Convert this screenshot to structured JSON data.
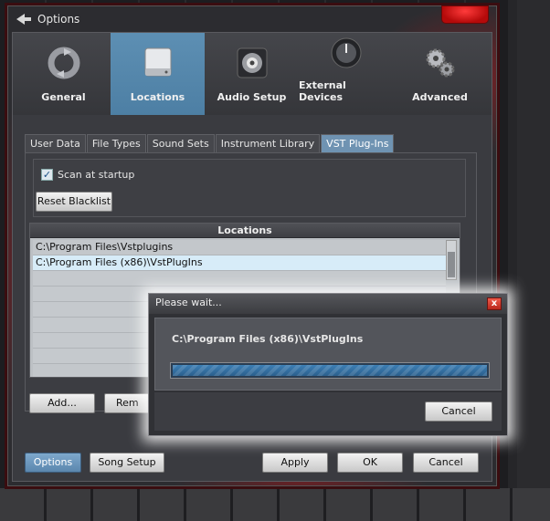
{
  "window": {
    "title": "Options"
  },
  "main_tabs": [
    {
      "label": "General",
      "icon": "refresh-icon"
    },
    {
      "label": "Locations",
      "icon": "drive-icon",
      "active": true
    },
    {
      "label": "Audio Setup",
      "icon": "speaker-icon"
    },
    {
      "label": "External Devices",
      "icon": "knob-icon"
    },
    {
      "label": "Advanced",
      "icon": "gears-icon"
    }
  ],
  "sub_tabs": [
    {
      "label": "User Data"
    },
    {
      "label": "File Types"
    },
    {
      "label": "Sound Sets"
    },
    {
      "label": "Instrument Library"
    },
    {
      "label": "VST Plug-Ins",
      "active": true
    }
  ],
  "scan": {
    "label": "Scan at startup",
    "checked": true,
    "reset_label": "Reset Blacklist"
  },
  "locations": {
    "header": "Locations",
    "items": [
      "C:\\Program Files\\Vstplugins",
      "C:\\Program Files (x86)\\VstPlugIns"
    ]
  },
  "list_buttons": {
    "add": "Add...",
    "remove": "Rem"
  },
  "footer": {
    "options": "Options",
    "song_setup": "Song Setup",
    "apply": "Apply",
    "ok": "OK",
    "cancel": "Cancel"
  },
  "dialog": {
    "title": "Please wait...",
    "close": "x",
    "path": "C:\\Program Files (x86)\\VstPlugIns",
    "progress": 1.0,
    "cancel": "Cancel"
  },
  "colors": {
    "accent": "#4d7fa4",
    "brand_red": "#b50a0a"
  }
}
